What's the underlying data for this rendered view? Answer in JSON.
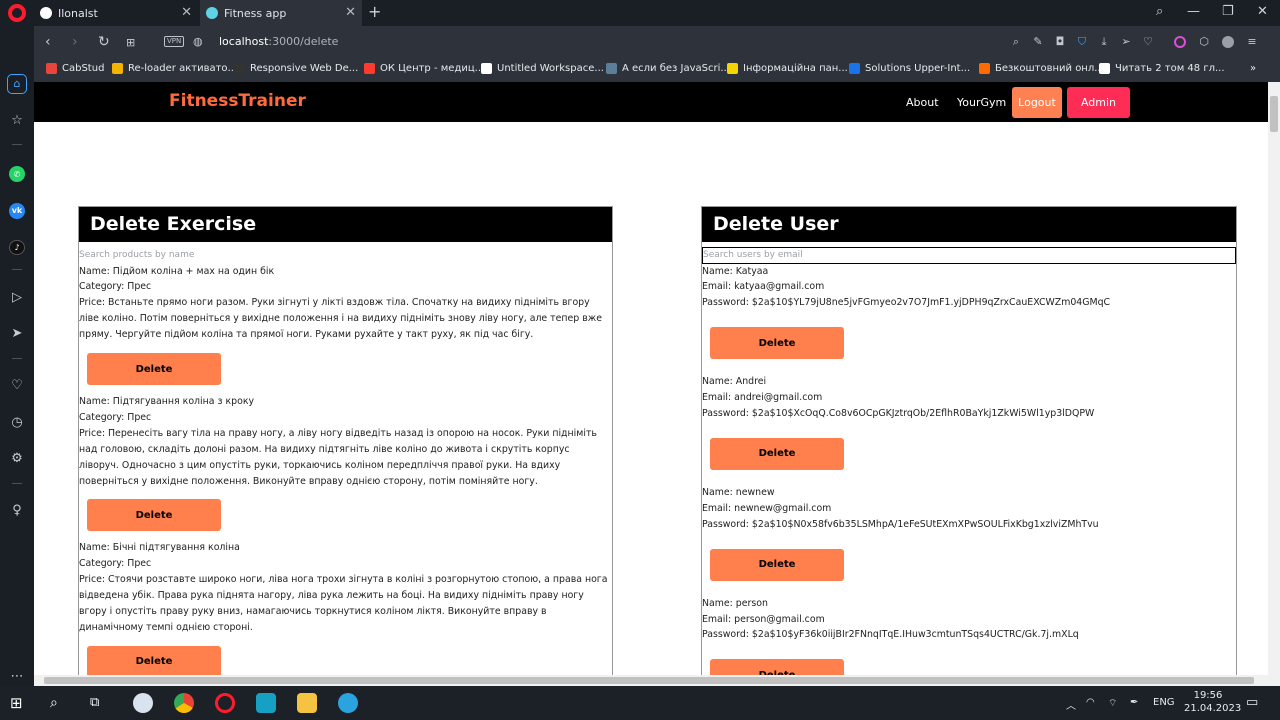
{
  "browser": {
    "tabs": [
      {
        "title": "Ilonalst"
      },
      {
        "title": "Fitness app"
      }
    ],
    "url_host": "localhost",
    "url_path": ":3000/delete",
    "vpn_label": "VPN",
    "bookmarks": [
      {
        "label": "CabStud",
        "color": "#e8453c"
      },
      {
        "label": "Re-loader активато...",
        "color": "#f4b400"
      },
      {
        "label": "Responsive Web De...",
        "color": "#333333"
      },
      {
        "label": "ОК Центр - медиц...",
        "color": "#ff3b30"
      },
      {
        "label": "Untitled Workspace...",
        "color": "#ffffff"
      },
      {
        "label": "А если без JavaScri...",
        "color": "#5d7e9b"
      },
      {
        "label": "Інформаційна пан...",
        "color": "#f5d400"
      },
      {
        "label": "Solutions Upper-Int...",
        "color": "#1a73e8"
      },
      {
        "label": "Безкоштовний онл...",
        "color": "#ff6a00"
      },
      {
        "label": "Читать 2 том 48 гл...",
        "color": "#ffffff"
      }
    ]
  },
  "nav": {
    "brand": "FitnessTrainer",
    "about": "About",
    "yourgym": "YourGym",
    "logout": "Logout",
    "admin": "Admin"
  },
  "exercise_panel": {
    "title": "Delete Exercise",
    "search_placeholder": "Search products by name",
    "delete_label": "Delete",
    "items": [
      {
        "name": "Name: Підйом коліна + мах на один бік",
        "category": "Category: Прес",
        "price": "Price: Встаньте прямо ноги разом. Руки зігнуті у лікті вздовж тіла. Спочатку на видиху підніміть вгору ліве коліно. Потім поверніться у вихідне положення і на видиху підніміть знову ліву ногу, але тепер вже пряму. Чергуйте підйом коліна та прямої ноги. Руками рухайте у такт руху, як під час бігу."
      },
      {
        "name": "Name: Підтягування коліна з кроку",
        "category": "Category: Прес",
        "price": "Price: Перенесіть вагу тіла на праву ногу, а ліву ногу відведіть назад із опорою на носок. Руки підніміть над головою, складіть долоні разом. На видиху підтягніть ліве коліно до живота і скрутіть корпус ліворуч. Одночасно з цим опустіть руки, торкаючись коліном передпліччя правої руки. На вдиху поверніться у вихідне положення. Виконуйте вправу однією сторону, потім поміняйте ногу."
      },
      {
        "name": "Name: Бічні підтягування коліна",
        "category": "Category: Прес",
        "price": "Price: Стоячи розставте широко ноги, ліва нога трохи зігнута в коліні з розгорнутою стопою, а права нога відведена убік. Права рука піднята нагору, ліва рука лежить на боці. На видиху підніміть праву ногу вгору і опустіть праву руку вниз, намагаючись торкнутися коліном ліктя. Виконуйте вправу в динамічному темпі однією стороні."
      }
    ]
  },
  "user_panel": {
    "title": "Delete User",
    "search_placeholder": "Search users by email",
    "delete_label": "Delete",
    "users": [
      {
        "name": "Name: Katyaa",
        "email": "Email: katyaa@gmail.com",
        "password": "Password: $2a$10$YL79jU8ne5jvFGmyeo2v7O7JmF1.yjDPH9qZrxCauEXCWZm04GMqC"
      },
      {
        "name": "Name: Andrei",
        "email": "Email: andrei@gmail.com",
        "password": "Password: $2a$10$XcOqQ.Co8v6OCpGKJztrqOb/2EflhR0BaYkj1ZkWi5Wl1yp3lDQPW"
      },
      {
        "name": "Name: newnew",
        "email": "Email: newnew@gmail.com",
        "password": "Password: $2a$10$N0x58fv6b35LSMhpA/1eFeSUtEXmXPwSOULFixKbg1xzlviZMhTvu"
      },
      {
        "name": "Name: person",
        "email": "Email: person@gmail.com",
        "password": "Password: $2a$10$yF36k0iijBIr2FNnqITqE.IHuw3cmtunTSqs4UCTRC/Gk.7j.mXLq"
      }
    ]
  },
  "taskbar": {
    "lang": "ENG",
    "time": "19:56",
    "date": "21.04.2023"
  }
}
